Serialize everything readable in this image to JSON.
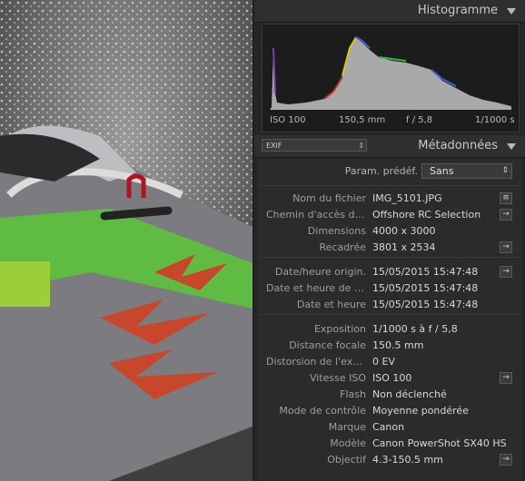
{
  "histogram": {
    "title": "Histogramme",
    "iso": "ISO 100",
    "focal": "150,5 mm",
    "aperture": "f / 5,8",
    "shutter": "1/1000 s"
  },
  "metadata": {
    "title": "Métadonnées",
    "view_select": "EXIF",
    "preset_label": "Param. prédéf.",
    "preset_value": "Sans",
    "groups": [
      [
        {
          "label": "Nom du fichier",
          "value": "IMG_5101.JPG",
          "button": "list-icon"
        },
        {
          "label": "Chemin d'accès de...",
          "value": "Offshore RC Selection",
          "button": "arrow-right-icon"
        },
        {
          "label": "Dimensions",
          "value": "4000 x 3000",
          "button": ""
        },
        {
          "label": "Recadrée",
          "value": "3801 x 2534",
          "button": "arrow-right-icon"
        }
      ],
      [
        {
          "label": "Date/heure origin.",
          "value": "15/05/2015 15:47:48",
          "button": "arrow-right-icon"
        },
        {
          "label": "Date et heure de n...",
          "value": "15/05/2015 15:47:48",
          "button": ""
        },
        {
          "label": "Date et heure",
          "value": "15/05/2015 15:47:48",
          "button": ""
        }
      ],
      [
        {
          "label": "Exposition",
          "value": "1/1000 s à f / 5,8",
          "button": ""
        },
        {
          "label": "Distance focale",
          "value": "150.5 mm",
          "button": ""
        },
        {
          "label": "Distorsion de l'exp...",
          "value": "0 EV",
          "button": ""
        },
        {
          "label": "Vitesse ISO",
          "value": "ISO 100",
          "button": "arrow-right-icon"
        },
        {
          "label": "Flash",
          "value": "Non déclenché",
          "button": ""
        },
        {
          "label": "Mode de contrôle",
          "value": "Moyenne pondérée",
          "button": ""
        },
        {
          "label": "Marque",
          "value": "Canon",
          "button": ""
        },
        {
          "label": "Modèle",
          "value": "Canon PowerShot SX40 HS",
          "button": ""
        },
        {
          "label": "Objectif",
          "value": "4.3-150.5 mm",
          "button": "arrow-right-icon"
        }
      ]
    ]
  }
}
